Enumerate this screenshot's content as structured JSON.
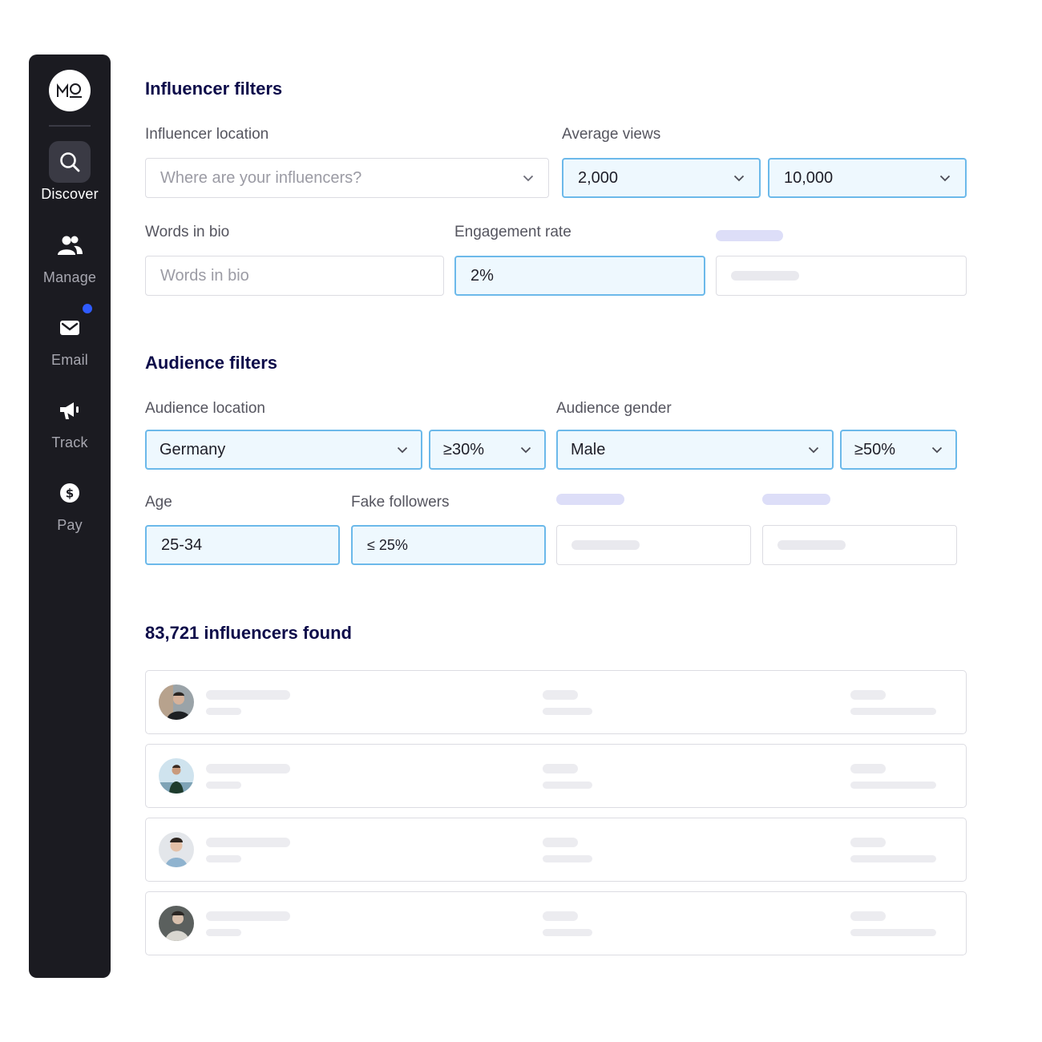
{
  "sidebar": {
    "logo_text": "MO",
    "items": [
      {
        "label": "Discover",
        "icon": "search-icon",
        "active": true
      },
      {
        "label": "Manage",
        "icon": "users-icon"
      },
      {
        "label": "Email",
        "icon": "envelope-icon",
        "has_notification": true
      },
      {
        "label": "Track",
        "icon": "megaphone-icon"
      },
      {
        "label": "Pay",
        "icon": "dollar-icon"
      }
    ]
  },
  "influencer_filters": {
    "title": "Influencer filters",
    "location": {
      "label": "Influencer location",
      "placeholder": "Where are your influencers?"
    },
    "average_views": {
      "label": "Average views",
      "min": "2,000",
      "max": "10,000"
    },
    "words_in_bio": {
      "label": "Words in bio",
      "placeholder": "Words in bio"
    },
    "engagement_rate": {
      "label": "Engagement rate",
      "value": "2%"
    }
  },
  "audience_filters": {
    "title": "Audience filters",
    "location": {
      "label": "Audience location",
      "value": "Germany",
      "threshold": "≥30%"
    },
    "gender": {
      "label": "Audience gender",
      "value": "Male",
      "threshold": "≥50%"
    },
    "age": {
      "label": "Age",
      "value": "25-34"
    },
    "fake_followers": {
      "label": "Fake followers",
      "value": "≤ 25%"
    }
  },
  "results": {
    "title": "83,721 influencers found",
    "row_count": 4
  },
  "colors": {
    "sidebar_bg": "#1b1b21",
    "accent_border": "#6cb9ea",
    "accent_fill": "#eef8fe",
    "notification": "#2f5bff",
    "heading": "#0d0c4a"
  }
}
